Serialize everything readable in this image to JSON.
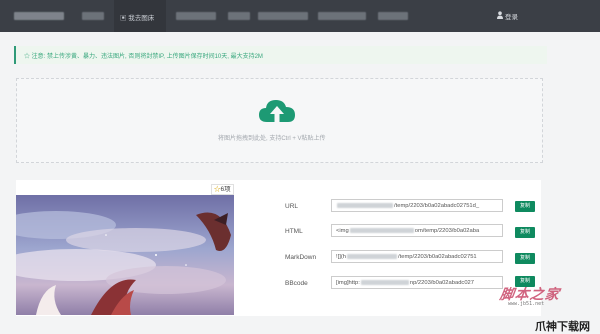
{
  "header": {
    "active_nav_label": "▣ 我去图床",
    "login_label": "登录"
  },
  "notice": {
    "text": "☆ 注意: 禁上传涉黄、暴力、违法图片, 否则将封禁IP, 上传图片保存时间10天, 最大支持2M"
  },
  "dropzone": {
    "hint": "将图片拖拽到此处, 支持Ctrl + V粘贴上传"
  },
  "result": {
    "badge_star": "☆",
    "badge_label": "6项",
    "rows": [
      {
        "label": "URL",
        "value_prefix": "",
        "value_suffix": "/temp/2203/b0a02abadc02751d_",
        "button": "复制"
      },
      {
        "label": "HTML",
        "value_prefix": "<img",
        "value_suffix": "om/temp/2203/b0a02aba",
        "button": "复制"
      },
      {
        "label": "MarkDown",
        "value_prefix": "![](h",
        "value_suffix": "/temp/2203/b0a02abadc02751",
        "button": "复制"
      },
      {
        "label": "BBcode",
        "value_prefix": "[img]http:",
        "value_suffix": "np/2203/b0a02abadc027",
        "button": "复制"
      }
    ]
  },
  "watermarks": {
    "script_logo": "脚本之家",
    "site": "www.jb51.net",
    "corner_logo": "爪神下载网"
  },
  "colors": {
    "topbar": "#3b3f46",
    "accent": "#0f8a5f",
    "notice_text": "#38a77d"
  },
  "icons": {
    "upload": "cloud-upload-icon",
    "user": "user-icon",
    "star": "star-icon"
  }
}
